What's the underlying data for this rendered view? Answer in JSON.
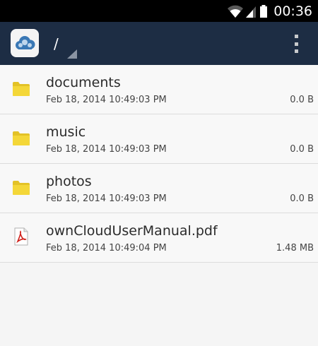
{
  "status_bar": {
    "time": "00:36",
    "icons": [
      "wifi-icon",
      "signal-icon",
      "battery-icon"
    ]
  },
  "action_bar": {
    "path": "/",
    "menu_icon": "overflow-menu-icon",
    "background": "#1d2d44"
  },
  "files": [
    {
      "name": "documents",
      "date": "Feb 18, 2014 10:49:03 PM",
      "size": "0.0 B",
      "icon": "folder-icon"
    },
    {
      "name": "music",
      "date": "Feb 18, 2014 10:49:03 PM",
      "size": "0.0 B",
      "icon": "folder-icon"
    },
    {
      "name": "photos",
      "date": "Feb 18, 2014 10:49:03 PM",
      "size": "0.0 B",
      "icon": "folder-icon"
    },
    {
      "name": "ownCloudUserManual.pdf",
      "date": "Feb 18, 2014 10:49:04 PM",
      "size": "1.48 MB",
      "icon": "pdf-file-icon"
    }
  ]
}
